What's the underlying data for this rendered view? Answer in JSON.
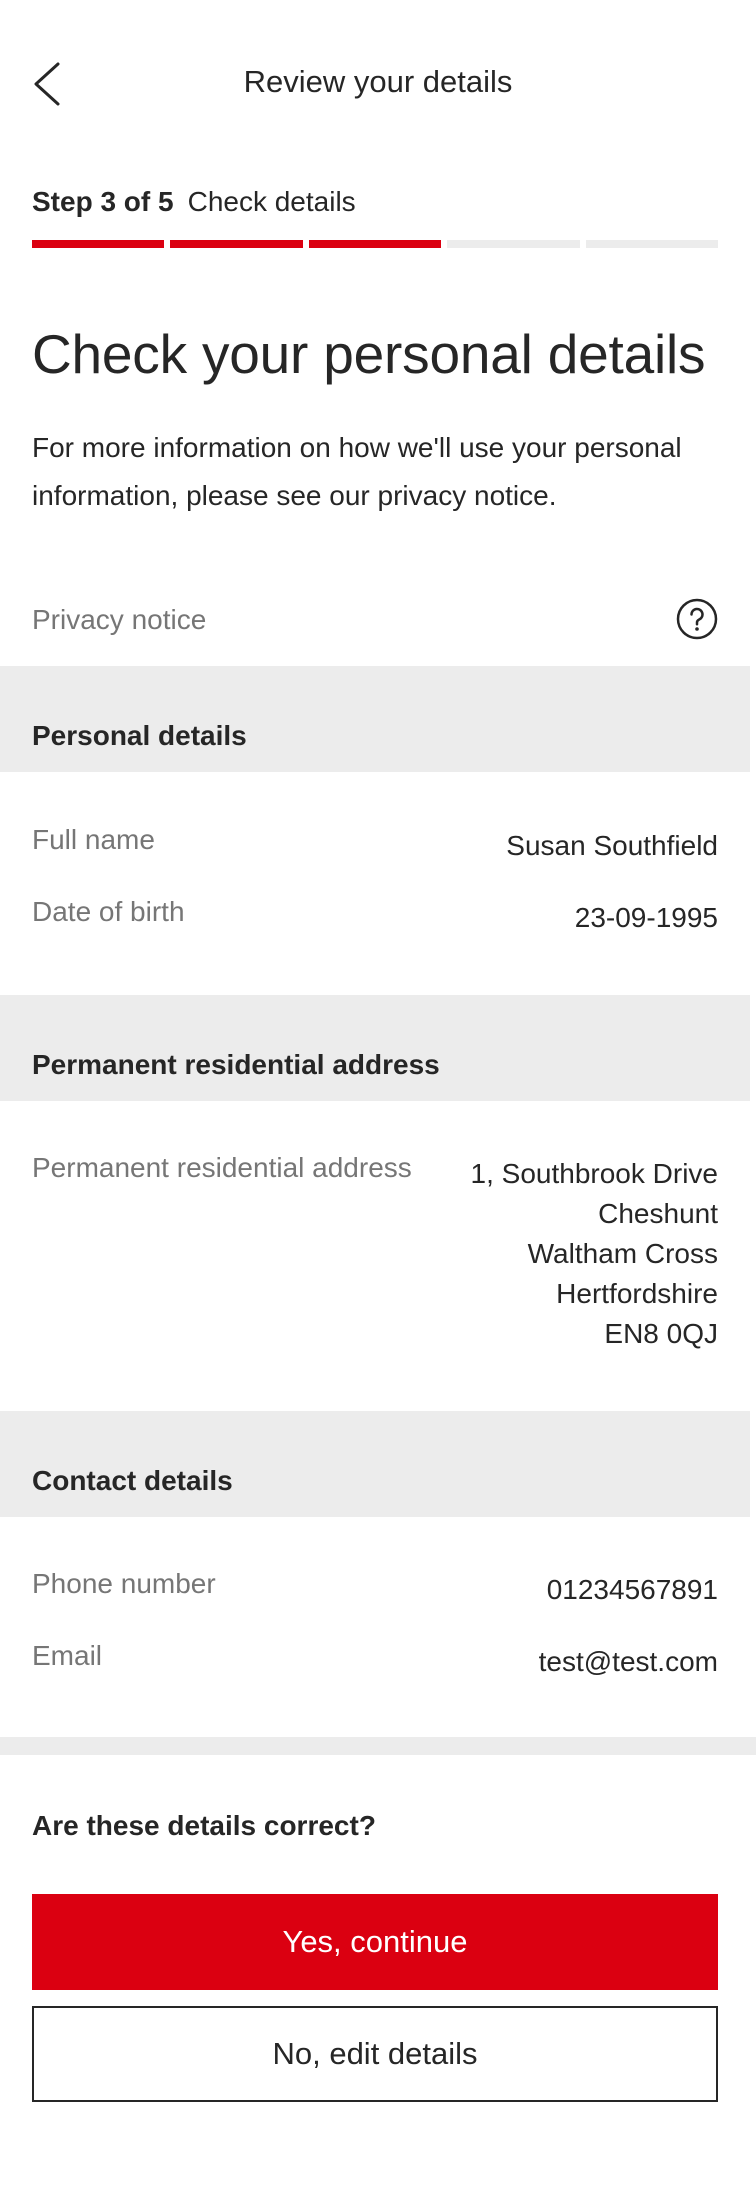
{
  "header": {
    "title": "Review your details",
    "back_icon": "chevron-left-icon"
  },
  "progress": {
    "step_label": "Step 3 of 5",
    "step_name": "Check details",
    "current": 3,
    "total": 5,
    "accent_color": "#db0011"
  },
  "page": {
    "heading": "Check your personal details",
    "intro": "For more information on how we'll use your personal information, please see our privacy notice."
  },
  "privacy": {
    "label": "Privacy notice",
    "icon": "question-circle-icon"
  },
  "sections": {
    "personal": {
      "title": "Personal details",
      "full_name_label": "Full name",
      "full_name_value": "Susan Southfield",
      "dob_label": "Date of birth",
      "dob_value": "23-09-1995"
    },
    "address": {
      "title": "Permanent residential address",
      "label": "Permanent residential address",
      "lines": [
        "1, Southbrook Drive",
        "Cheshunt",
        "Waltham Cross",
        "Hertfordshire",
        "EN8 0QJ"
      ]
    },
    "contact": {
      "title": "Contact details",
      "phone_label": "Phone number",
      "phone_value": "01234567891",
      "email_label": "Email",
      "email_value": "test@test.com"
    }
  },
  "confirm": {
    "question": "Are these details correct?",
    "yes_label": "Yes, continue",
    "no_label": "No, edit details"
  }
}
